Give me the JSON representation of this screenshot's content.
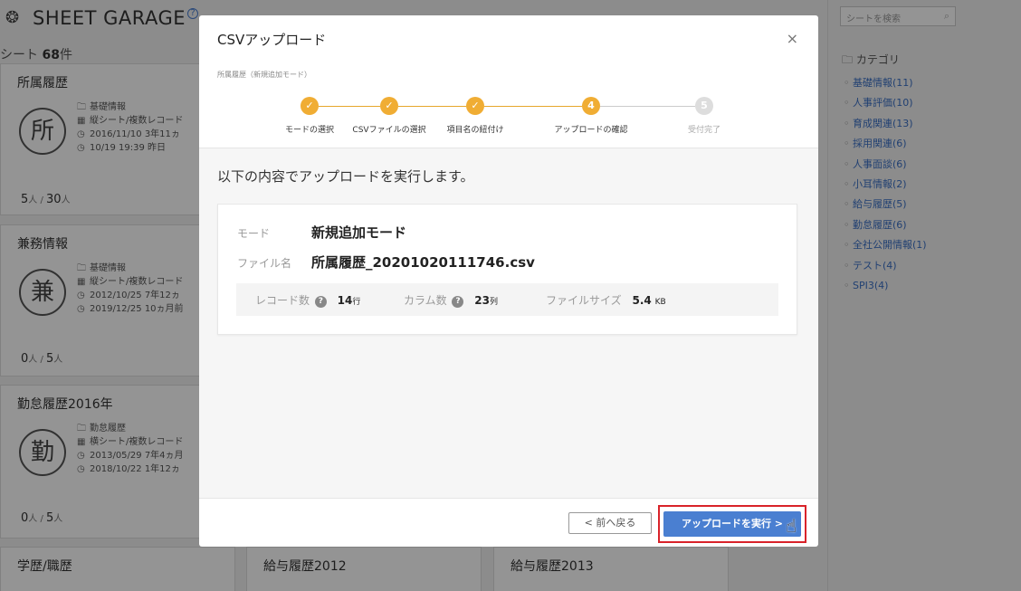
{
  "app": {
    "brand": "SHEET GARAGE",
    "help_mark": "?",
    "sheet_count_label": "シート",
    "sheet_count_value": "68",
    "sheet_count_unit": "件",
    "search_placeholder": "シートを検索",
    "category_title": "カテゴリ",
    "categories": [
      "基礎情報(11)",
      "人事評価(10)",
      "育成関連(13)",
      "採用関連(6)",
      "人事面談(6)",
      "小耳情報(2)",
      "給与履歴(5)",
      "勤怠履歴(6)",
      "全社公開情報(1)",
      "テスト(4)",
      "SPI3(4)"
    ],
    "cards": [
      {
        "title": "所属履歴",
        "badge": "所",
        "category": "基礎情報",
        "type": "縦シート/複数レコード",
        "created": "2016/11/10 3年11ヵ",
        "updated": "10/19 19:39 昨日",
        "count_a": "5",
        "count_b": "30"
      },
      {
        "title": "兼務情報",
        "badge": "兼",
        "category": "基礎情報",
        "type": "縦シート/複数レコード",
        "created": "2012/10/25 7年12ヵ",
        "updated": "2019/12/25 10ヵ月前",
        "count_a": "0",
        "count_b": "5"
      },
      {
        "title": "勤怠履歴2016年",
        "badge": "勤",
        "category": "勤怠履歴",
        "type": "横シート/複数レコード",
        "created": "2013/05/29 7年4ヵ月",
        "updated": "2018/10/22 1年12ヵ",
        "count_a": "0",
        "count_b": "5"
      }
    ],
    "person_unit": "人",
    "count_sep": " / ",
    "bottom_cards": [
      "学歴/職歴",
      "給与履歴2012",
      "給与履歴2013"
    ]
  },
  "modal": {
    "title": "CSVアップロード",
    "close": "×",
    "subtitle": "所属履歴（新規追加モード）",
    "steps": [
      {
        "label": "モードの選択",
        "mark": "✓",
        "state": "done"
      },
      {
        "label": "CSVファイルの選択",
        "mark": "✓",
        "state": "done"
      },
      {
        "label": "項目名の紐付け",
        "mark": "✓",
        "state": "done"
      },
      {
        "label": "アップロードの確認",
        "mark": "4",
        "state": "current"
      },
      {
        "label": "受付完了",
        "mark": "5",
        "state": "pending"
      }
    ],
    "message": "以下の内容でアップロードを実行します。",
    "mode_label": "モード",
    "mode_value": "新規追加モード",
    "file_label": "ファイル名",
    "file_value": "所属履歴_20201020111746.csv",
    "records_label": "レコード数",
    "records_value": "14",
    "records_unit": "行",
    "columns_label": "カラム数",
    "columns_value": "23",
    "columns_unit": "列",
    "size_label": "ファイルサイズ",
    "size_value": "5.4",
    "size_unit": "KB",
    "back_button": "< 前へ戻る",
    "execute_button": "アップロードを実行 >"
  },
  "colors": {
    "accent": "#4a7fd1",
    "step": "#f0ad34",
    "highlight": "#d9232a"
  }
}
